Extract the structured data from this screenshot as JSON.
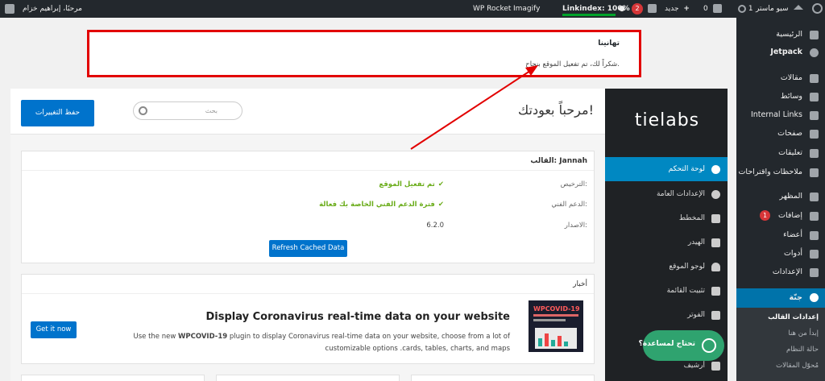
{
  "adminbar": {
    "site_name": "سيو ماستر",
    "updates_count": "1",
    "comments_count": "0",
    "new_label": "جديد",
    "yoast_badge": "2",
    "linkindex": "Linkindex: 100%",
    "imagify": "Imagify",
    "wp_rocket": "WP Rocket",
    "greeting": "مرحبًا، إبراهيم خزام"
  },
  "menu": {
    "items": [
      {
        "label": "الرئيسية",
        "icon": "dashboard-icon"
      },
      {
        "label": "Jetpack",
        "icon": "jetpack-icon"
      },
      {
        "label": "مقالات",
        "icon": "pin-icon"
      },
      {
        "label": "وسائط",
        "icon": "media-icon"
      },
      {
        "label": "Internal Links",
        "icon": "link-icon"
      },
      {
        "label": "صفحات",
        "icon": "pages-icon"
      },
      {
        "label": "تعليقات",
        "icon": "comments-icon"
      },
      {
        "label": "ملاحظات واقتراحات",
        "icon": "feedback-icon"
      },
      {
        "label": "المظهر",
        "icon": "appearance-icon"
      },
      {
        "label": "إضافات",
        "icon": "plugins-icon",
        "badge": "1"
      },
      {
        "label": "أعضاء",
        "icon": "users-icon"
      },
      {
        "label": "أدوات",
        "icon": "tools-icon"
      },
      {
        "label": "الإعدادات",
        "icon": "settings-icon"
      },
      {
        "label": "جنّة",
        "icon": "info-icon"
      }
    ],
    "submenu": [
      "إعدادات القالب",
      "إبدأ من هنا",
      "حالة النظام",
      "مُحوّل المقالات"
    ]
  },
  "notice": {
    "title": "تهانينا",
    "message": "شكراً لك، تم تفعيل الموقع بنجاح."
  },
  "tie": {
    "logo": "tielabs",
    "items": [
      "لوحة التحكم",
      "الإعدادات العامة",
      "المخطط",
      "الهيدر",
      "لوجو الموقع",
      "تثبيت القائمة",
      "الفوتر",
      "أرشيف"
    ]
  },
  "toolbar": {
    "save_label": "حفظ التغييرات",
    "search_placeholder": "بحث",
    "welcome": "مرحباً بعودتك!"
  },
  "theme_box": {
    "title": "القالب: Jannah",
    "rows": [
      {
        "key": "الترخيص:",
        "value": "تم تفعيل الموقع"
      },
      {
        "key": "الدعم الفني:",
        "value": "فترة الدعم الفني الخاصة بك فعالة"
      },
      {
        "key": "الاصدار:",
        "value": "6.2.0"
      }
    ],
    "refresh_label": "Refresh Cached Data"
  },
  "news_box": {
    "title": "أخبار",
    "image_caption": "WPCOVID-19",
    "headline": "Display Coronavirus real-time data on your website",
    "body_prefix": "Use the new ",
    "body_bold": "WPCOVID-19",
    "body_suffix": " plugin to display Coronavirus real-time data on your website, choose from a lot of customizable options .cards, tables, charts, and maps",
    "cta": "Get it now"
  },
  "help": {
    "label": "تحتاج لمساعدة؟"
  }
}
